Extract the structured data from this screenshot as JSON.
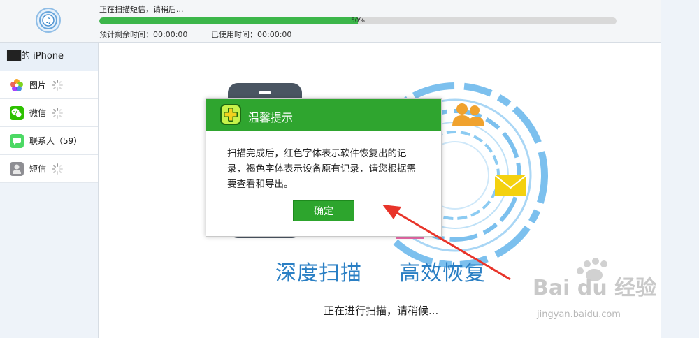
{
  "topbar": {
    "scan_status": "正在扫描短信，请稍后...",
    "progress_fraction": 0.5,
    "progress_label": "50%",
    "time_remaining": "预计剩余时间：00:00:00",
    "time_used": "已使用时间：00:00:00"
  },
  "sidebar": {
    "device_name": "██的 iPhone",
    "items": [
      {
        "label": "图片",
        "icon": "photos-icon"
      },
      {
        "label": "微信",
        "icon": "wechat-icon"
      },
      {
        "label": "联系人（59）",
        "icon": "contacts-icon"
      },
      {
        "label": "短信",
        "icon": "messages-icon"
      }
    ]
  },
  "main": {
    "slogan_left": "深度扫描",
    "slogan_right": "高效恢复",
    "scan_message": "正在进行扫描，请稍候..."
  },
  "dialog": {
    "title": "温馨提示",
    "message": "扫描完成后，红色字体表示软件恢复出的记录，褐色字体表示设备原有记录，请您根据需要查看和导出。",
    "ok_label": "确定"
  },
  "watermark": {
    "brand": "Bai du 经验",
    "url": "jingyan.baidu.com"
  },
  "colors": {
    "progress_fill": "#3cb64a",
    "dialog_header": "#2fa52f",
    "slogan": "#2a7fc4",
    "annotation_arrow": "#e8342a"
  }
}
